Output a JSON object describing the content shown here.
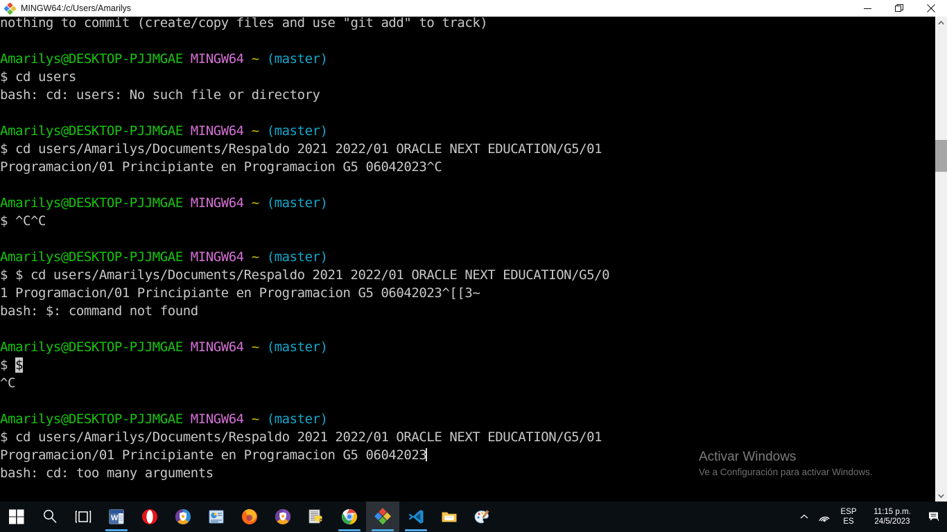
{
  "window": {
    "title": "MINGW64:/c/Users/Amarilys",
    "app_icon": "mingw-diamond-icon",
    "controls": {
      "minimize": "minimize-icon",
      "restore": "restore-icon",
      "close": "close-icon"
    }
  },
  "terminal": {
    "prompt_user_host": "Amarilys@DESKTOP-PJJMGAE",
    "prompt_shell": "MINGW64",
    "prompt_path": "~",
    "prompt_branch": "(master)",
    "lines": [
      {
        "type": "text",
        "text": "nothing to commit (create/copy files and use \"git add\" to track)"
      },
      {
        "type": "blank"
      },
      {
        "type": "prompt"
      },
      {
        "type": "text",
        "text": "$ cd users"
      },
      {
        "type": "text",
        "text": "bash: cd: users: No such file or directory"
      },
      {
        "type": "blank"
      },
      {
        "type": "prompt"
      },
      {
        "type": "text",
        "text": "$ cd users/Amarilys/Documents/Respaldo 2021 2022/01 ORACLE NEXT EDUCATION/G5/01"
      },
      {
        "type": "text",
        "text": "Programacion/01 Principiante en Programacion G5 06042023^C"
      },
      {
        "type": "blank"
      },
      {
        "type": "prompt"
      },
      {
        "type": "text",
        "text": "$ ^C^C"
      },
      {
        "type": "blank"
      },
      {
        "type": "prompt"
      },
      {
        "type": "text",
        "text": "$ $ cd users/Amarilys/Documents/Respaldo 2021 2022/01 ORACLE NEXT EDUCATION/G5/0"
      },
      {
        "type": "text",
        "text": "1 Programacion/01 Principiante en Programacion G5 06042023^[[3~"
      },
      {
        "type": "text",
        "text": "bash: $: command not found"
      },
      {
        "type": "blank"
      },
      {
        "type": "prompt"
      },
      {
        "type": "cursor_block",
        "before": "$ ",
        "cursor": "$"
      },
      {
        "type": "text",
        "text": "^C"
      },
      {
        "type": "blank"
      },
      {
        "type": "prompt"
      },
      {
        "type": "text",
        "text": "$ cd users/Amarilys/Documents/Respaldo 2021 2022/01 ORACLE NEXT EDUCATION/G5/01"
      },
      {
        "type": "cursor_bar",
        "text": "Programacion/01 Principiante en Programacion G5 06042023"
      },
      {
        "type": "text",
        "text": "bash: cd: too many arguments"
      }
    ],
    "colors": {
      "background": "#000000",
      "foreground": "#c8c8c8",
      "user_host": "#16c60c",
      "shell": "#d670d6",
      "path": "#c5c500",
      "branch": "#11a8cd",
      "cursor": "#cccccc"
    }
  },
  "watermark": {
    "title": "Activar Windows",
    "subtitle": "Ve a Configuración para activar Windows."
  },
  "scrollbar": {
    "up_arrow": "chevron-up-icon",
    "down_arrow": "chevron-down-icon"
  },
  "taskbar": {
    "start": {
      "name": "start-button",
      "icon": "windows-logo-icon"
    },
    "items": [
      {
        "name": "search-button",
        "icon": "search-icon",
        "active": false
      },
      {
        "name": "task-view-button",
        "icon": "task-view-icon",
        "active": false
      },
      {
        "name": "taskbar-word",
        "icon": "word-icon",
        "active": true
      },
      {
        "name": "taskbar-opera",
        "icon": "opera-icon",
        "active": false
      },
      {
        "name": "taskbar-avast",
        "icon": "avast-shield-icon",
        "active": false
      },
      {
        "name": "taskbar-powerpoint",
        "icon": "powerpoint-icon",
        "active": false
      },
      {
        "name": "taskbar-firefox",
        "icon": "firefox-icon",
        "active": false
      },
      {
        "name": "taskbar-avg",
        "icon": "avg-shield-icon",
        "active": false
      },
      {
        "name": "taskbar-python-idle",
        "icon": "python-idle-icon",
        "active": false
      },
      {
        "name": "taskbar-chrome",
        "icon": "chrome-icon",
        "active": true
      },
      {
        "name": "taskbar-git-bash",
        "icon": "git-bash-icon",
        "active": true
      },
      {
        "name": "taskbar-vscode",
        "icon": "vscode-icon",
        "active": true
      },
      {
        "name": "taskbar-file-explorer",
        "icon": "file-explorer-icon",
        "active": false
      },
      {
        "name": "taskbar-paint",
        "icon": "paint-icon",
        "active": false
      }
    ],
    "tray": {
      "chevron": "chevron-up-icon",
      "network": "wifi-icon",
      "language_top": "ESP",
      "language_bottom": "ES",
      "time": "11:15 p.m.",
      "date": "24/5/2023",
      "notifications": "notification-icon"
    }
  }
}
